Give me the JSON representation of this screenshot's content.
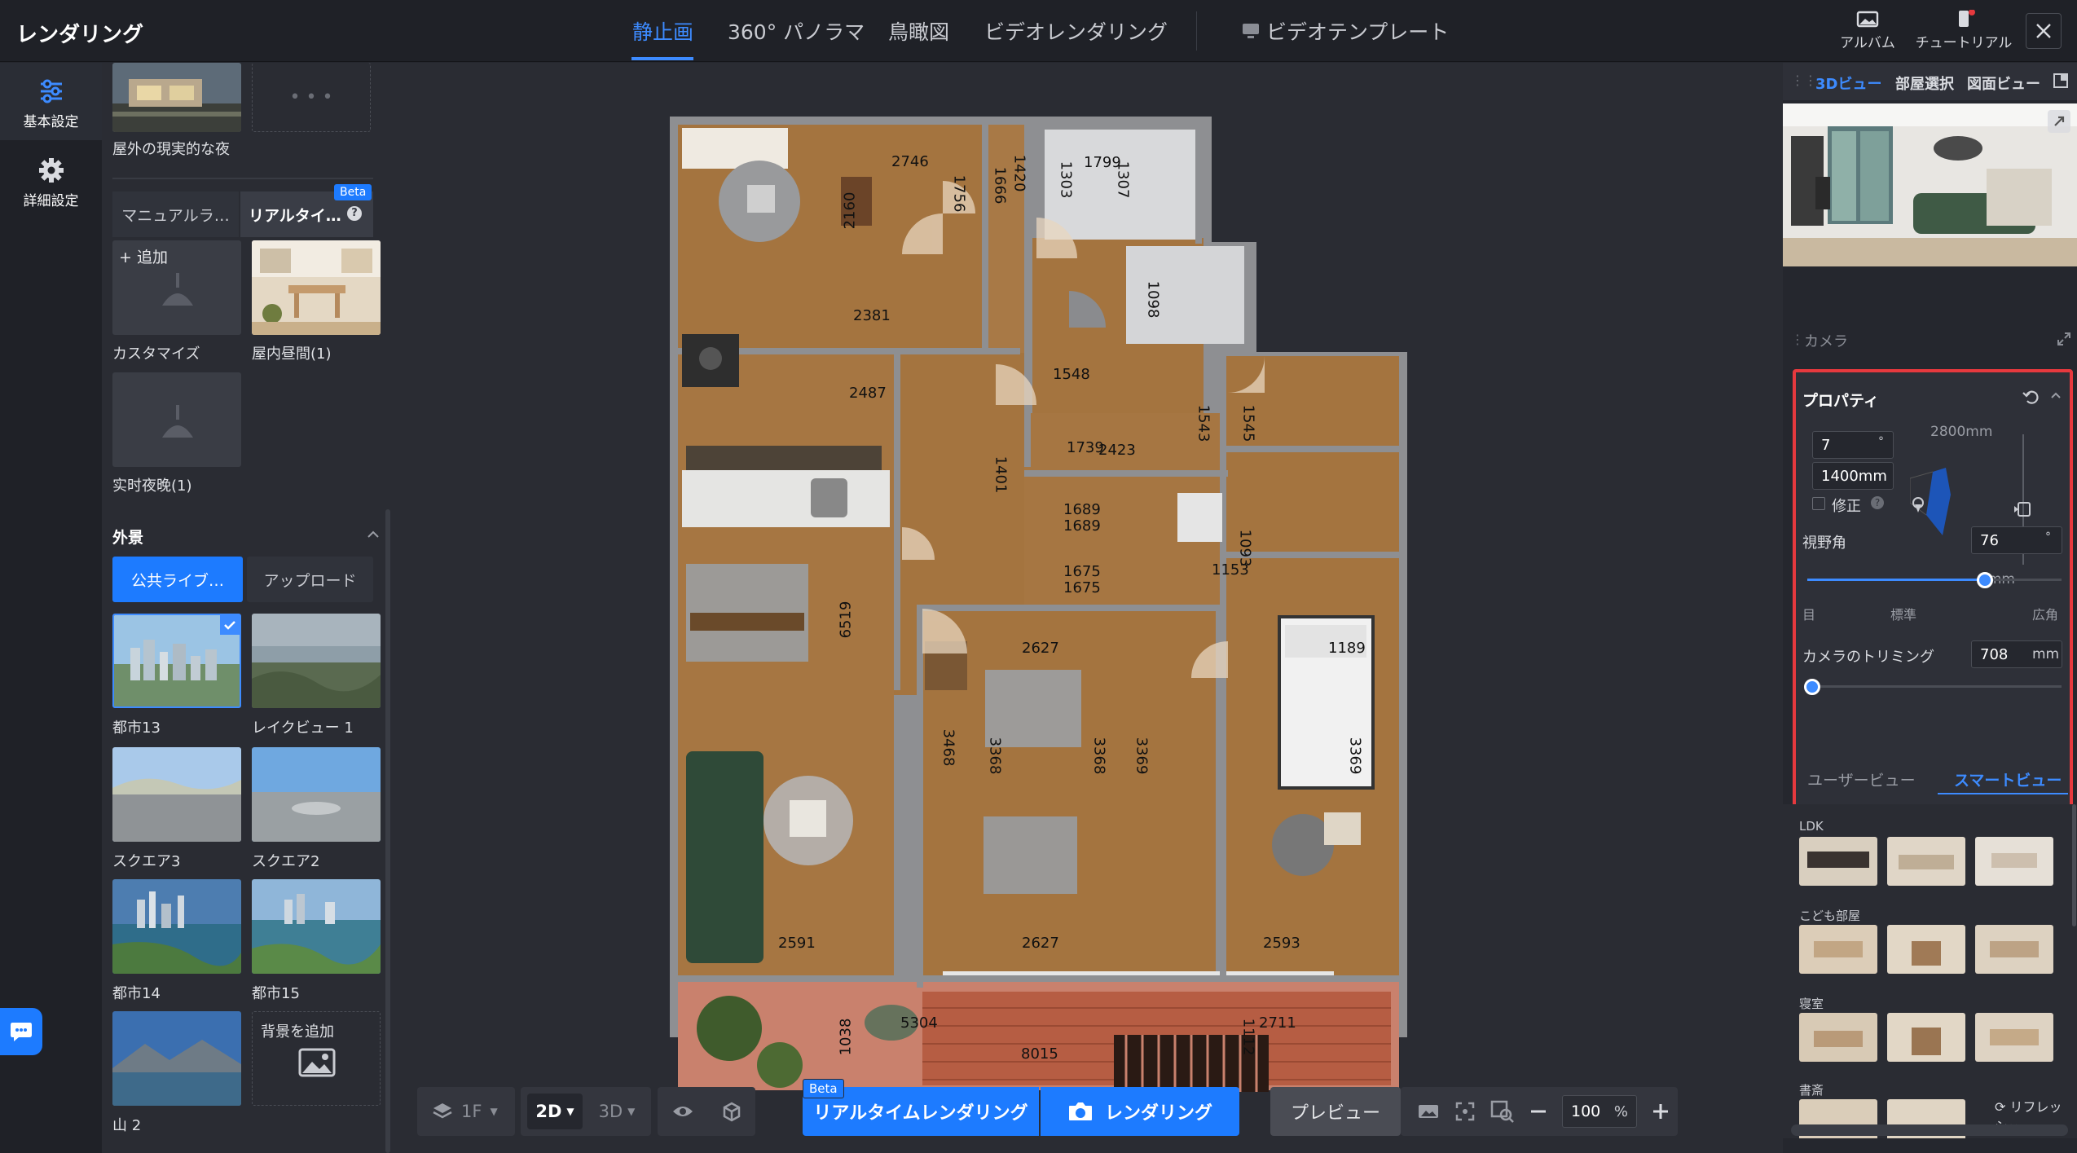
{
  "app": {
    "title": "レンダリング"
  },
  "tabs": [
    {
      "label": "静止画",
      "active": true
    },
    {
      "label": "360° パノラマ"
    },
    {
      "label": "鳥瞰図"
    },
    {
      "label": "ビデオレンダリング"
    },
    {
      "label": "ビデオテンプレート"
    }
  ],
  "top_actions": {
    "album": "アルバム",
    "tutorial": "チュートリアル"
  },
  "rail": {
    "basic": "基本設定",
    "advanced": "詳細設定"
  },
  "left_panel": {
    "top_caption": "屋外の現実的な夜",
    "mode_tabs": {
      "manual": "マニュアルラ…",
      "realtime": "リアルタイ…",
      "beta": "Beta"
    },
    "light_items": [
      {
        "caption": "カスタマイズ",
        "add_label": "+ 追加"
      },
      {
        "caption": "屋内昼間(1)"
      },
      {
        "caption": "实时夜晚(1)"
      }
    ],
    "exterior_header": "外景",
    "source_tabs": {
      "public": "公共ライブ…",
      "upload": "アップロード"
    },
    "backgrounds": [
      {
        "caption": "都市13",
        "selected": true
      },
      {
        "caption": "レイクビュー 1"
      },
      {
        "caption": "スクエア3"
      },
      {
        "caption": "スクエア2"
      },
      {
        "caption": "都市14"
      },
      {
        "caption": "都市15"
      },
      {
        "caption": "山 2"
      }
    ],
    "add_background": "背景を追加"
  },
  "plan_labels": {
    "d2746": "2746",
    "d2160": "2160",
    "d1756": "1756",
    "d1666": "1666",
    "d1420": "1420",
    "d1303": "1303",
    "d1799": "1799",
    "d1307": "1307",
    "d1098": "1098",
    "d2381": "2381",
    "d2487": "2487",
    "d1548": "1548",
    "d1543": "1543",
    "d1545": "1545",
    "d1739": "1739",
    "d2423": "2423",
    "d1401": "1401",
    "d1689a": "1689",
    "d1689b": "1689",
    "d1675a": "1675",
    "d1675b": "1675",
    "d1093": "1093",
    "d1153": "1153",
    "d6519": "6519",
    "d2627a": "2627",
    "d1189": "1189",
    "d3468": "3468",
    "d3368a": "3368",
    "d3368b": "3368",
    "d3369a": "3369",
    "d3369b": "3369",
    "d2591": "2591",
    "d2627b": "2627",
    "d2593": "2593",
    "d5304": "5304",
    "d2711": "2711",
    "d1038": "1038",
    "d8015": "8015",
    "d1112": "1112"
  },
  "bottom_toolbar": {
    "floor": "1F",
    "view2d": "2D",
    "view3d": "3D",
    "beta": "Beta",
    "realtime": "リアルタイムレンダリング",
    "render": "レンダリング",
    "preview": "プレビュー",
    "zoom": "100",
    "zoom_unit": "%"
  },
  "right_panel": {
    "view_tabs": {
      "v3d": "3Dビュー",
      "room": "部屋選択",
      "plan": "図面ビュー"
    },
    "camera_title": "カメラ",
    "properties_title": "プロパティ",
    "fields": {
      "angle": "7",
      "angle_unit": "°",
      "height": "1400mm",
      "fix_label": "修正",
      "top_mm": "2800mm",
      "bottom_mm": "0mm"
    },
    "fov": {
      "label": "視野角",
      "value": "76",
      "unit": "°",
      "fraction": 0.7,
      "ticks": [
        "目",
        "標準",
        "広角"
      ]
    },
    "trim": {
      "label": "カメラのトリミング",
      "value": "708",
      "unit": "mm",
      "fraction": 0.02
    },
    "view_mode_tabs": {
      "user": "ユーザービュー",
      "smart": "スマートビュー"
    },
    "room_groups": [
      "LDK",
      "こども部屋",
      "寝室",
      "書斎"
    ],
    "refresh": "リフレッシュ"
  },
  "colors": {
    "accent": "#3d8bff",
    "highlight": "#e6393e",
    "panel": "#2a2c33",
    "wood": "#a4743f"
  }
}
